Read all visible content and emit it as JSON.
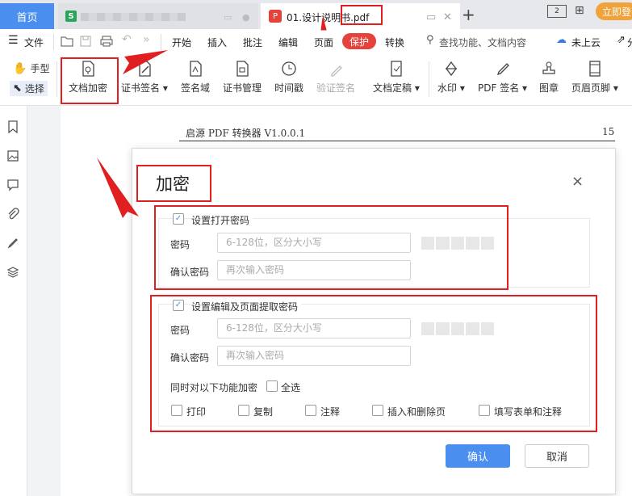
{
  "tabs": {
    "home_label": "首页",
    "sheet_icon_text": "S",
    "doc_title": "01.设计说明书.pdf",
    "pdf_icon_text": "P",
    "new_tab": "+"
  },
  "window": {
    "login_label": "立即登"
  },
  "menu": {
    "file": "文件",
    "items": [
      "开始",
      "插入",
      "批注",
      "编辑",
      "页面",
      "保护",
      "转换"
    ],
    "search_placeholder": "查找功能、文档内容",
    "cloud_label": "未上云",
    "share_label": "分"
  },
  "toolbar": {
    "hand": "手型",
    "select": "选择",
    "tools": [
      "文档加密",
      "证书签名",
      "签名域",
      "证书管理",
      "时间戳",
      "验证签名",
      "文档定稿",
      "水印",
      "PDF 签名",
      "图章",
      "页眉页脚"
    ]
  },
  "document": {
    "header_text": "启源 PDF 转换器 V1.0.0.1",
    "page_number": "15"
  },
  "dialog": {
    "title": "加密",
    "open_section_label": "设置打开密码",
    "edit_section_label": "设置编辑及页面提取密码",
    "password_label": "密码",
    "confirm_label": "确认密码",
    "password_placeholder": "6-128位，区分大小写",
    "confirm_placeholder": "再次输入密码",
    "restrict_label": "同时对以下功能加密",
    "select_all": "全选",
    "permissions": [
      "打印",
      "复制",
      "注释",
      "插入和删除页",
      "填写表单和注释"
    ],
    "ok": "确认",
    "cancel": "取消",
    "check_mark": "✓",
    "close_glyph": "×"
  },
  "colors": {
    "accent": "#4a8ff0",
    "protect_red": "#e4423b",
    "annotation_red": "#e02020"
  }
}
